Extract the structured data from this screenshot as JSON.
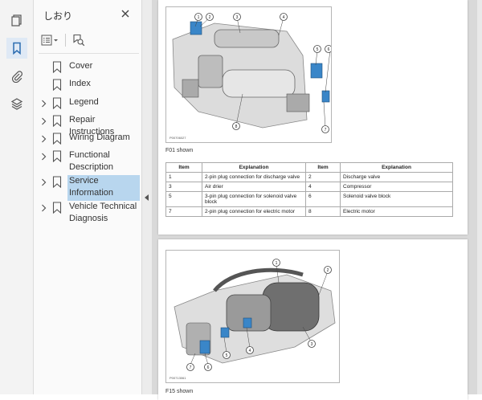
{
  "panel": {
    "title": "しおり"
  },
  "bookmarks": [
    {
      "label": "Cover",
      "expandable": false
    },
    {
      "label": "Index",
      "expandable": false
    },
    {
      "label": "Legend",
      "expandable": true
    },
    {
      "label": "Repair Instructions",
      "expandable": true
    },
    {
      "label": "Wiring Diagram",
      "expandable": true
    },
    {
      "label": "Functional Description",
      "expandable": true
    },
    {
      "label": "Service Information",
      "expandable": true,
      "selected": true
    },
    {
      "label": "Vehicle Technical Diagnosis",
      "expandable": true
    }
  ],
  "document": {
    "figure1": {
      "code": "P00706027",
      "callouts": [
        "1",
        "2",
        "3",
        "4",
        "5",
        "6",
        "7",
        "8"
      ]
    },
    "caption1": "F01 shown",
    "table": {
      "headers": [
        "Item",
        "Explanation",
        "Item",
        "Explanation"
      ],
      "rows": [
        [
          "1",
          "2-pin plug connection for discharge valve",
          "2",
          "Discharge valve"
        ],
        [
          "3",
          "Air drier",
          "4",
          "Compressor"
        ],
        [
          "5",
          "3-pin plug connection for solenoid valve block",
          "6",
          "Solenoid valve block"
        ],
        [
          "7",
          "2-pin plug connection for electric motor",
          "8",
          "Electric motor"
        ]
      ]
    },
    "figure2": {
      "code": "P00713061",
      "callouts": [
        "1",
        "2",
        "3",
        "4",
        "5",
        "6",
        "7"
      ]
    },
    "caption2": "F15 shown"
  },
  "colors": {
    "accent": "#2b6cb0",
    "selection": "#b8d6ee",
    "part_blue": "#3a86c8"
  }
}
